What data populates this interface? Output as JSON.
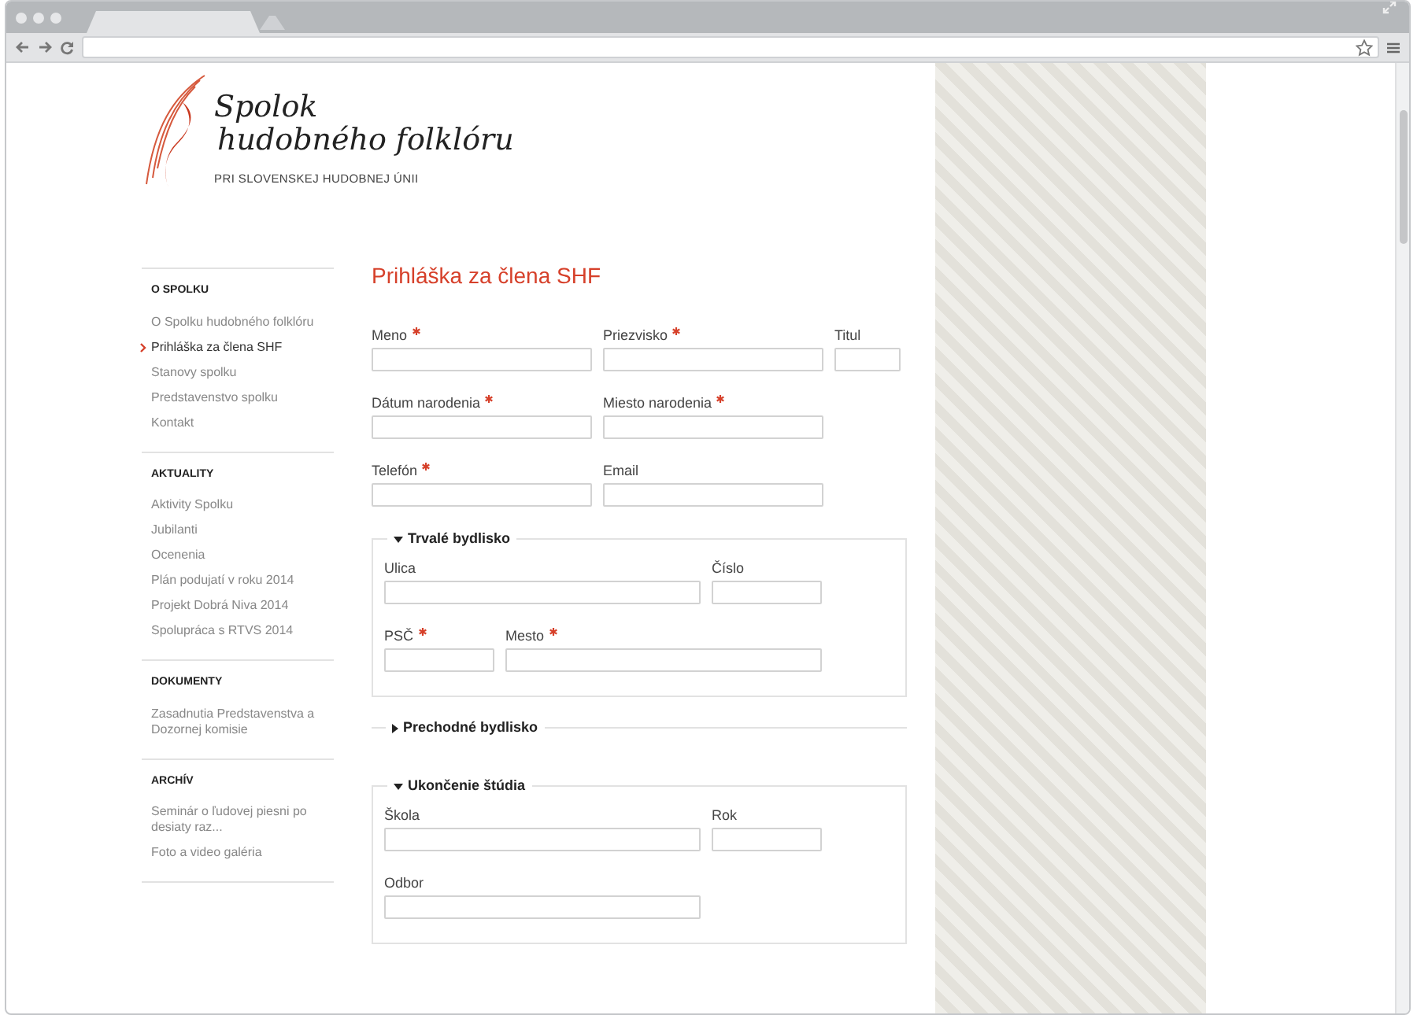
{
  "browser": {
    "tabs": [
      {
        "selected": true
      },
      {
        "selected": false
      }
    ]
  },
  "logo": {
    "line_1": "Spolok",
    "line_2": "hudobného folklóru",
    "subtitle": "PRI SLOVENSKEJ HUDOBNEJ ÚNII"
  },
  "sidebar": {
    "sections": [
      {
        "heading": "O SPOLKU",
        "items": [
          {
            "label": "O Spolku hudobného folklóru",
            "selected": false
          },
          {
            "label": "Prihláška za člena SHF",
            "selected": true
          },
          {
            "label": "Stanovy spolku",
            "selected": false
          },
          {
            "label": "Predstavenstvo spolku",
            "selected": false
          },
          {
            "label": "Kontakt",
            "selected": false
          }
        ]
      },
      {
        "heading": "AKTUALITY",
        "items": [
          {
            "label": "Aktivity Spolku",
            "selected": false
          },
          {
            "label": "Jubilanti",
            "selected": false
          },
          {
            "label": "Ocenenia",
            "selected": false
          },
          {
            "label": "Plán podujatí v roku 2014",
            "selected": false
          },
          {
            "label": "Projekt Dobrá Niva 2014",
            "selected": false
          },
          {
            "label": "Spolupráca s RTVS 2014",
            "selected": false
          }
        ]
      },
      {
        "heading": "DOKUMENTY",
        "items": [
          {
            "label": "Zasadnutia Predstavenstva a Dozornej komisie",
            "selected": false
          }
        ]
      },
      {
        "heading": "ARCHÍV",
        "items": [
          {
            "label": "Seminár o ľudovej piesni po desiaty raz...",
            "selected": false
          },
          {
            "label": "Foto a video galéria",
            "selected": false
          }
        ]
      }
    ]
  },
  "form": {
    "title": "Prihláška za člena SHF",
    "rows": [
      [
        {
          "label": "Meno",
          "required": true,
          "kind": "medium"
        },
        {
          "label": "Priezvisko",
          "required": true,
          "kind": "medium"
        },
        {
          "label": "Titul",
          "required": false,
          "kind": "tiny"
        }
      ],
      [
        {
          "label": "Dátum narodenia",
          "required": true,
          "kind": "medium"
        },
        {
          "label": "Miesto narodenia",
          "required": true,
          "kind": "medium"
        }
      ],
      [
        {
          "label": "Telefón",
          "required": true,
          "kind": "medium"
        },
        {
          "label": "Email",
          "required": false,
          "kind": "medium"
        }
      ]
    ],
    "fieldsets": [
      {
        "legend": "Trvalé bydlisko",
        "expanded": true,
        "rows": [
          [
            {
              "label": "Ulica",
              "required": false,
              "kind": "long"
            },
            {
              "label": "Číslo",
              "required": false,
              "kind": "short"
            }
          ],
          [
            {
              "label": "PSČ",
              "required": true,
              "kind": "short"
            },
            {
              "label": "Mesto",
              "required": true,
              "kind": "long"
            }
          ]
        ]
      },
      {
        "legend": "Prechodné bydlisko",
        "expanded": false
      },
      {
        "legend": "Ukončenie štúdia",
        "expanded": true,
        "rows": [
          [
            {
              "label": "Škola",
              "required": false,
              "kind": "long"
            },
            {
              "label": "Rok",
              "required": false,
              "kind": "short"
            }
          ],
          [
            {
              "label": "Odbor",
              "required": false,
              "kind": "long"
            }
          ]
        ]
      }
    ]
  }
}
